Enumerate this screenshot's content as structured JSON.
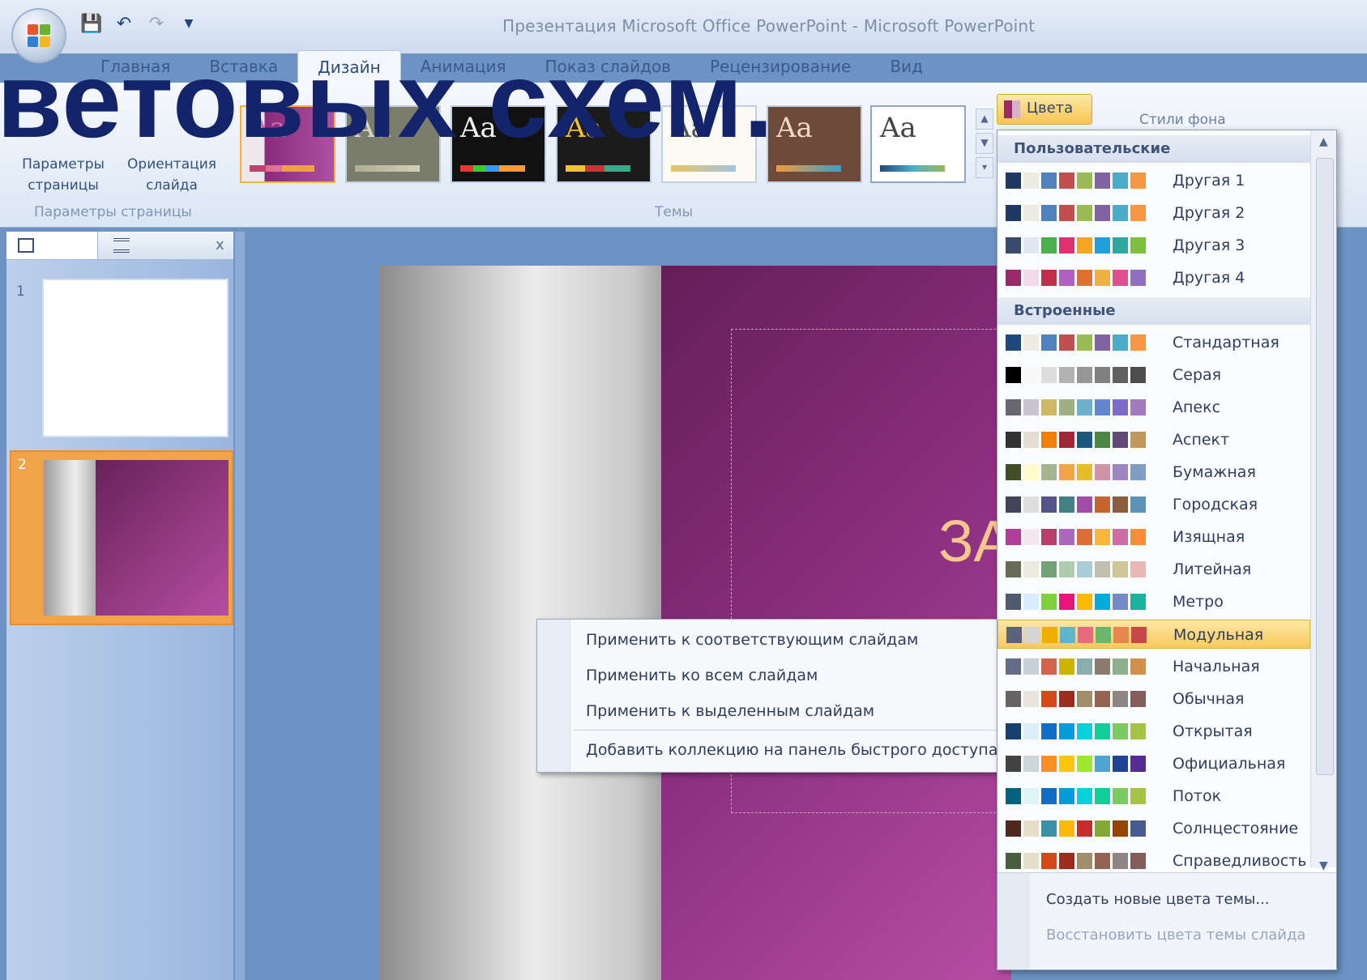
{
  "window": {
    "title": "Презентация Microsoft Office PowerPoint - Microsoft PowerPoint"
  },
  "overlay_title": "ветовых  схем.",
  "tabs": [
    {
      "label": "Главная"
    },
    {
      "label": "Вставка"
    },
    {
      "label": "Дизайн",
      "active": true
    },
    {
      "label": "Анимация"
    },
    {
      "label": "Показ слайдов"
    },
    {
      "label": "Рецензирование"
    },
    {
      "label": "Вид"
    }
  ],
  "ribbon": {
    "page_setup_button": "Параметры страницы",
    "orientation_button": "Ориентация слайда",
    "page_group_label": "Параметры страницы",
    "themes_group_label": "Темы",
    "theme_thumb_text": "Aa",
    "colors_button": "Цвета",
    "font_styles_button": "Стили фона"
  },
  "slides_pane": {
    "slide_numbers": [
      "1",
      "2"
    ],
    "close": "x"
  },
  "context_menu": {
    "items": [
      "Применить к соответствующим слайдам",
      "Применить ко всем слайдам",
      "Применить к выделенным слайдам",
      "Добавить коллекцию на панель быстрого доступа"
    ]
  },
  "colors_dropdown": {
    "custom_header": "Пользовательские",
    "builtin_header": "Встроенные",
    "custom": [
      {
        "name": "Другая 1",
        "colors": [
          "#1f3864",
          "#eeece1",
          "#4f81bd",
          "#c0504d",
          "#9bbb59",
          "#8064a2",
          "#4bacc6",
          "#f79646"
        ]
      },
      {
        "name": "Другая 2",
        "colors": [
          "#1f3864",
          "#eeece1",
          "#4f81bd",
          "#c0504d",
          "#9bbb59",
          "#8064a2",
          "#4bacc6",
          "#f79646"
        ]
      },
      {
        "name": "Другая 3",
        "colors": [
          "#3a4a6b",
          "#dfe8f3",
          "#4bb04b",
          "#e0306e",
          "#f5a623",
          "#20a0d8",
          "#2fa8a0",
          "#7fbf3f"
        ]
      },
      {
        "name": "Другая 4",
        "colors": [
          "#9c2a6b",
          "#f2dbe8",
          "#c0304a",
          "#b060c0",
          "#e07030",
          "#f0b040",
          "#e05090",
          "#8f6fbf"
        ]
      }
    ],
    "builtin": [
      {
        "name": "Стандартная",
        "colors": [
          "#1f497d",
          "#eeece1",
          "#4f81bd",
          "#c0504d",
          "#9bbb59",
          "#8064a2",
          "#4bacc6",
          "#f79646"
        ]
      },
      {
        "name": "Серая",
        "colors": [
          "#000000",
          "#f8f8f8",
          "#dddddd",
          "#b2b2b2",
          "#969696",
          "#808080",
          "#5f5f5f",
          "#4d4d4d"
        ]
      },
      {
        "name": "Апекс",
        "colors": [
          "#69676d",
          "#c9c2d1",
          "#ceb966",
          "#9cb084",
          "#6bb1c9",
          "#6585cf",
          "#7e6bc9",
          "#a379bb"
        ]
      },
      {
        "name": "Аспект",
        "colors": [
          "#323232",
          "#e3ded1",
          "#f07f09",
          "#9f2936",
          "#1b587c",
          "#4e8542",
          "#604878",
          "#c19859"
        ]
      },
      {
        "name": "Бумажная",
        "colors": [
          "#444d26",
          "#fefac9",
          "#a5b592",
          "#f3a447",
          "#e7bc29",
          "#d092a7",
          "#9c85c0",
          "#809ec2"
        ]
      },
      {
        "name": "Городская",
        "colors": [
          "#424456",
          "#dedede",
          "#53548a",
          "#438086",
          "#a04da3",
          "#c4652d",
          "#8b5d3d",
          "#5c92b5"
        ]
      },
      {
        "name": "Изящная",
        "colors": [
          "#b13f9a",
          "#f4e7ed",
          "#b83d68",
          "#ac66bb",
          "#de6c36",
          "#f9b639",
          "#cf6da4",
          "#fa8d3d"
        ]
      },
      {
        "name": "Литейная",
        "colors": [
          "#676a55",
          "#eaebde",
          "#72a376",
          "#b0ccb0",
          "#a8cdd7",
          "#c0beaf",
          "#cec597",
          "#e8b7b7"
        ]
      },
      {
        "name": "Метро",
        "colors": [
          "#4e5b6f",
          "#d6ecff",
          "#7fd13b",
          "#ea157a",
          "#feb80a",
          "#00addc",
          "#738ac8",
          "#1ab39f"
        ]
      },
      {
        "name": "Модульная",
        "colors": [
          "#5a6378",
          "#d4d4d4",
          "#f0ad00",
          "#60b5cc",
          "#e66c7d",
          "#6bb76d",
          "#e88651",
          "#c64847"
        ],
        "highlighted": true
      },
      {
        "name": "Начальная",
        "colors": [
          "#646b86",
          "#c5d1d7",
          "#d16349",
          "#ccb400",
          "#8cadae",
          "#8c7b70",
          "#8fb08c",
          "#d19049"
        ]
      },
      {
        "name": "Обычная",
        "colors": [
          "#696464",
          "#e9e5dc",
          "#d34817",
          "#9b2d1f",
          "#a28e6a",
          "#956251",
          "#918485",
          "#855d5d"
        ]
      },
      {
        "name": "Открытая",
        "colors": [
          "#17406d",
          "#dbeff9",
          "#0f6fc6",
          "#009dd9",
          "#0bd0d9",
          "#10cf9b",
          "#7cca62",
          "#a5c249"
        ]
      },
      {
        "name": "Официальная",
        "colors": [
          "#434342",
          "#cdd7d9",
          "#f7901e",
          "#fec60b",
          "#9fe62f",
          "#4ea5d1",
          "#1c4596",
          "#542d90"
        ]
      },
      {
        "name": "Поток",
        "colors": [
          "#04617b",
          "#dbf5f9",
          "#0f6fc6",
          "#009dd9",
          "#0bd0d9",
          "#10cf9b",
          "#7cca62",
          "#a5c249"
        ]
      },
      {
        "name": "Солнцестояние",
        "colors": [
          "#4f271c",
          "#e7dec9",
          "#3891a7",
          "#feb80a",
          "#c32d2e",
          "#84aa33",
          "#964305",
          "#475a8d"
        ]
      },
      {
        "name": "Справедливость",
        "colors": [
          "#4a5e3e",
          "#e7dec9",
          "#d34817",
          "#9b2d1f",
          "#a28e6a",
          "#956251",
          "#918485",
          "#855d5d"
        ]
      }
    ],
    "create_new": "Создать новые цвета темы...",
    "reset": "Восстановить цвета темы слайда"
  },
  "slide": {
    "title_fragment": "ЗА"
  }
}
